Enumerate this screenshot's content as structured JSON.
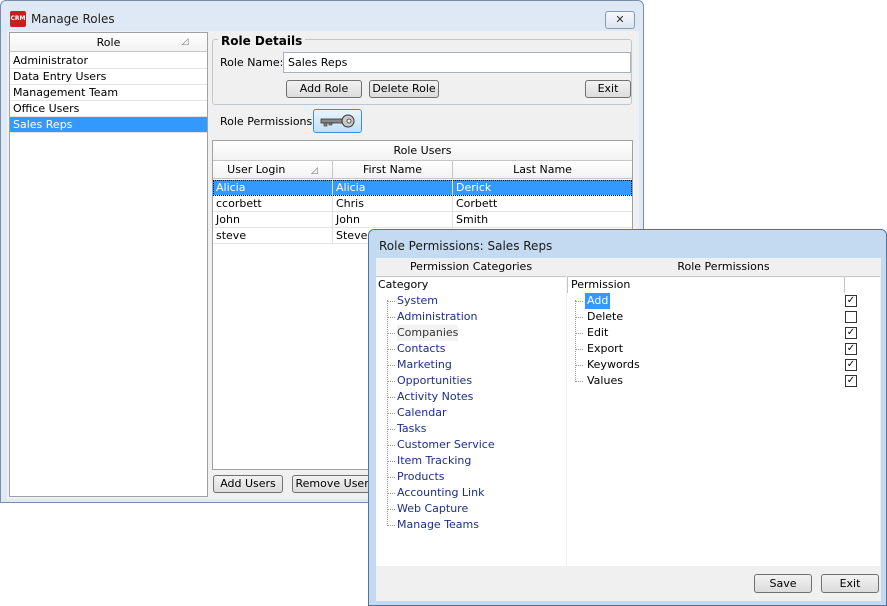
{
  "main_window": {
    "title": "Manage Roles",
    "app_icon_text": "CRM",
    "close_glyph": "✕"
  },
  "role_list": {
    "header": "Role",
    "items": [
      "Administrator",
      "Data Entry Users",
      "Management Team",
      "Office Users",
      "Sales Reps"
    ],
    "selected": "Sales Reps"
  },
  "role_details": {
    "legend": "Role Details",
    "name_label": "Role Name:",
    "name_value": "Sales Reps",
    "add_role": "Add Role",
    "delete_role": "Delete Role",
    "exit": "Exit",
    "permissions_label": "Role Permissions"
  },
  "role_users": {
    "caption": "Role Users",
    "columns": [
      "User Login",
      "First Name",
      "Last Name"
    ],
    "rows": [
      [
        "Alicia",
        "Alicia",
        "Derick"
      ],
      [
        "ccorbett",
        "Chris",
        "Corbett"
      ],
      [
        "John",
        "John",
        "Smith"
      ],
      [
        "steve",
        "Steve",
        ""
      ]
    ],
    "add_users": "Add Users",
    "remove_users": "Remove Users"
  },
  "permissions_window": {
    "title": "Role Permissions: Sales Reps",
    "categories_header": "Permission Categories",
    "role_permissions_header": "Role Permissions",
    "category_col": "Category",
    "permission_col": "Permission",
    "categories": [
      "System",
      "Administration",
      "Companies",
      "Contacts",
      "Marketing",
      "Opportunities",
      "Activity Notes",
      "Calendar",
      "Tasks",
      "Customer Service",
      "Item Tracking",
      "Products",
      "Accounting Link",
      "Web Capture",
      "Manage Teams"
    ],
    "highlighted_category": "Companies",
    "permissions": [
      {
        "name": "Add",
        "checked": true
      },
      {
        "name": "Delete",
        "checked": false
      },
      {
        "name": "Edit",
        "checked": true
      },
      {
        "name": "Export",
        "checked": true
      },
      {
        "name": "Keywords",
        "checked": true
      },
      {
        "name": "Values",
        "checked": true
      }
    ],
    "selected_permission": "Add",
    "save": "Save",
    "exit": "Exit"
  }
}
